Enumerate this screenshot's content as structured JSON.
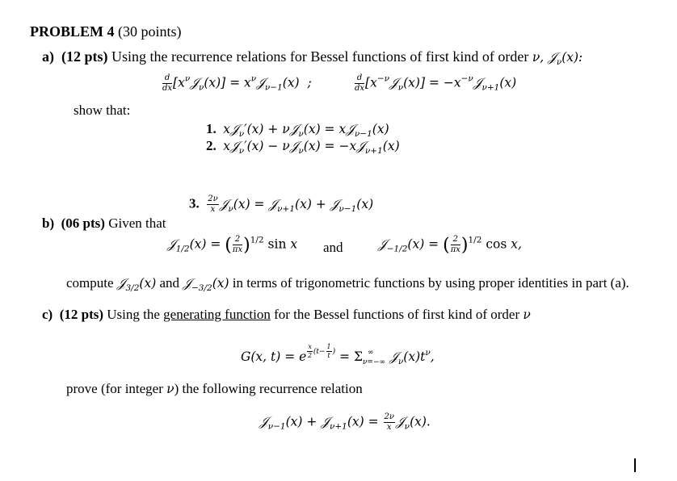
{
  "problem": {
    "title": "PROBLEM 4",
    "points": "(30 points)"
  },
  "part_a": {
    "label": "a)",
    "points": "(12 pts)",
    "intro": "Using the recurrence relations for Bessel functions of first kind of order ",
    "intro_symbol": "ν, 𝒥ν(x):",
    "relation_1": "[x^ν 𝒥ν(x)] = x^ν 𝒥ν−1(x) ;",
    "relation_2": "[x^−ν 𝒥ν(x)] = −x^−ν 𝒥ν+1(x)",
    "show_that": "show that:",
    "items": [
      {
        "num": "1.",
        "expr": "x𝒥ν′(x) + ν𝒥ν(x) = x𝒥ν−1(x)"
      },
      {
        "num": "2.",
        "expr": "x𝒥ν′(x) − ν𝒥ν(x) = −x𝒥ν+1(x)"
      },
      {
        "num": "3.",
        "expr": "(2ν/x)𝒥ν(x) = 𝒥ν+1(x) + 𝒥ν−1(x)"
      }
    ]
  },
  "part_b": {
    "label": "b)",
    "points": "(06 pts)",
    "intro": "Given that",
    "eq_1": "𝒥1/2(x) = (2/πx)^1/2 sin x",
    "and": "and",
    "eq_2": "𝒥−1/2(x) = (2/πx)^1/2 cos x,",
    "task_pre": "compute ",
    "task_sym1": "𝒥3/2(x)",
    "task_mid": " and ",
    "task_sym2": "𝒥−3/2(x)",
    "task_post": " in terms of trigonometric functions by using proper identities in part (a)."
  },
  "part_c": {
    "label": "c)",
    "points": "(12 pts)",
    "intro_pre": "Using the ",
    "intro_link": "generating function",
    "intro_post": " for the Bessel functions of first kind of order ",
    "intro_symbol": "ν",
    "generating": "G(x,t) = e^{(x/2)(t−1/t)} = Σ_{ν=−∞}^{∞} 𝒥ν(x) t^ν,",
    "prove_pre": "prove (for integer ",
    "prove_sym": "ν",
    "prove_post": ") the following recurrence relation",
    "final": "𝒥ν−1(x) + 𝒥ν+1(x) = (2ν/x)𝒥ν(x)."
  }
}
